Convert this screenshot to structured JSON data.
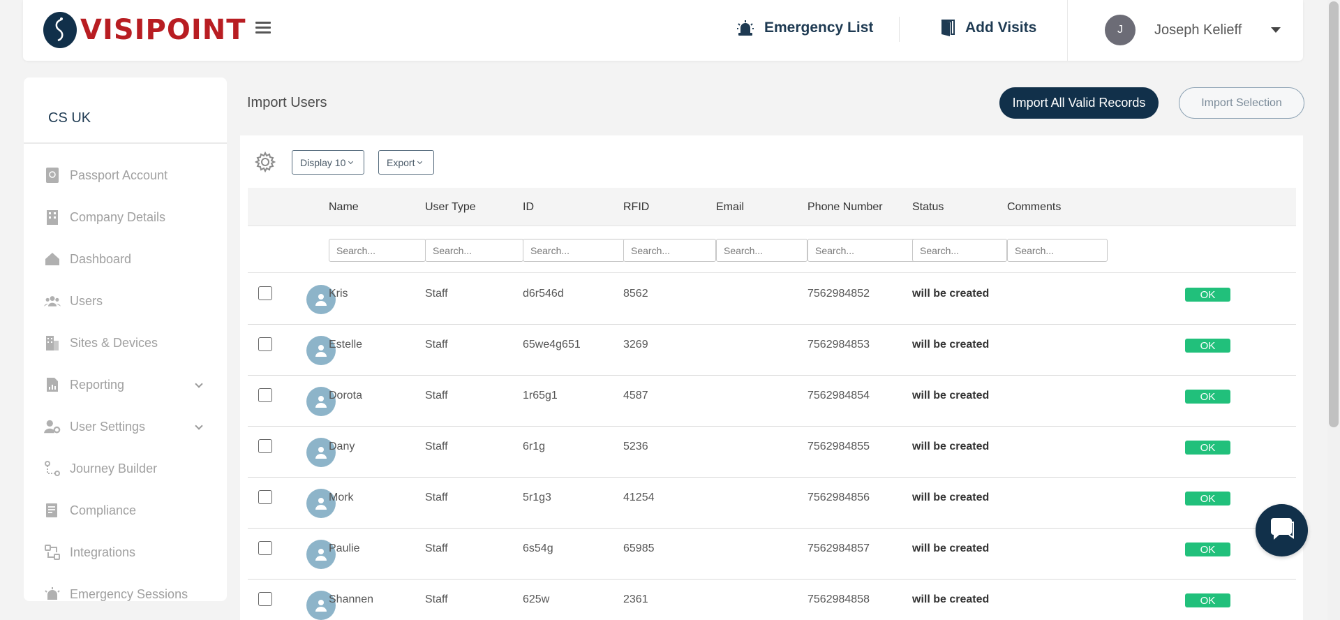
{
  "header": {
    "logo_text": "VISIPOINT",
    "emergency_label": "Emergency List",
    "visits_label": "Add Visits",
    "user_initial": "J",
    "user_name": "Joseph Kelieff"
  },
  "sidebar": {
    "org": "CS UK",
    "items": [
      {
        "label": "Passport Account",
        "icon": "passport-icon"
      },
      {
        "label": "Company Details",
        "icon": "building-icon"
      },
      {
        "label": "Dashboard",
        "icon": "home-icon"
      },
      {
        "label": "Users",
        "icon": "users-icon"
      },
      {
        "label": "Sites & Devices",
        "icon": "sites-icon"
      },
      {
        "label": "Reporting",
        "icon": "report-icon",
        "has_children": true
      },
      {
        "label": "User Settings",
        "icon": "user-settings-icon",
        "has_children": true
      },
      {
        "label": "Journey Builder",
        "icon": "journey-icon"
      },
      {
        "label": "Compliance",
        "icon": "compliance-icon"
      },
      {
        "label": "Integrations",
        "icon": "integrations-icon"
      },
      {
        "label": "Emergency Sessions",
        "icon": "alarm-icon"
      }
    ]
  },
  "main": {
    "title": "Import Users",
    "import_all_label": "Import All Valid Records",
    "import_selection_label": "Import Selection",
    "display_label": "Display 10",
    "export_label": "Export",
    "search_placeholder": "Search...",
    "columns": [
      "Name",
      "User Type",
      "ID",
      "RFID",
      "Email",
      "Phone Number",
      "Status",
      "Comments"
    ],
    "rows": [
      {
        "name": "Kris",
        "type": "Staff",
        "id": "d6r546d",
        "rfid": "8562",
        "email": "",
        "phone": "7562984852",
        "status": "will be created",
        "comment": "OK"
      },
      {
        "name": "Estelle",
        "type": "Staff",
        "id": "65we4g651",
        "rfid": "3269",
        "email": "",
        "phone": "7562984853",
        "status": "will be created",
        "comment": "OK"
      },
      {
        "name": "Dorota",
        "type": "Staff",
        "id": "1r65g1",
        "rfid": "4587",
        "email": "",
        "phone": "7562984854",
        "status": "will be created",
        "comment": "OK"
      },
      {
        "name": "Dany",
        "type": "Staff",
        "id": "6r1g",
        "rfid": "5236",
        "email": "",
        "phone": "7562984855",
        "status": "will be created",
        "comment": "OK"
      },
      {
        "name": "Mork",
        "type": "Staff",
        "id": "5r1g3",
        "rfid": "41254",
        "email": "",
        "phone": "7562984856",
        "status": "will be created",
        "comment": "OK"
      },
      {
        "name": "Paulie",
        "type": "Staff",
        "id": "6s54g",
        "rfid": "65985",
        "email": "",
        "phone": "7562984857",
        "status": "will be created",
        "comment": "OK"
      },
      {
        "name": "Shannen",
        "type": "Staff",
        "id": "625w",
        "rfid": "2361",
        "email": "",
        "phone": "7562984858",
        "status": "will be created",
        "comment": "OK"
      }
    ]
  },
  "colors": {
    "brand_red": "#b81d22",
    "navy": "#11304a",
    "ok_green": "#21c07b"
  }
}
